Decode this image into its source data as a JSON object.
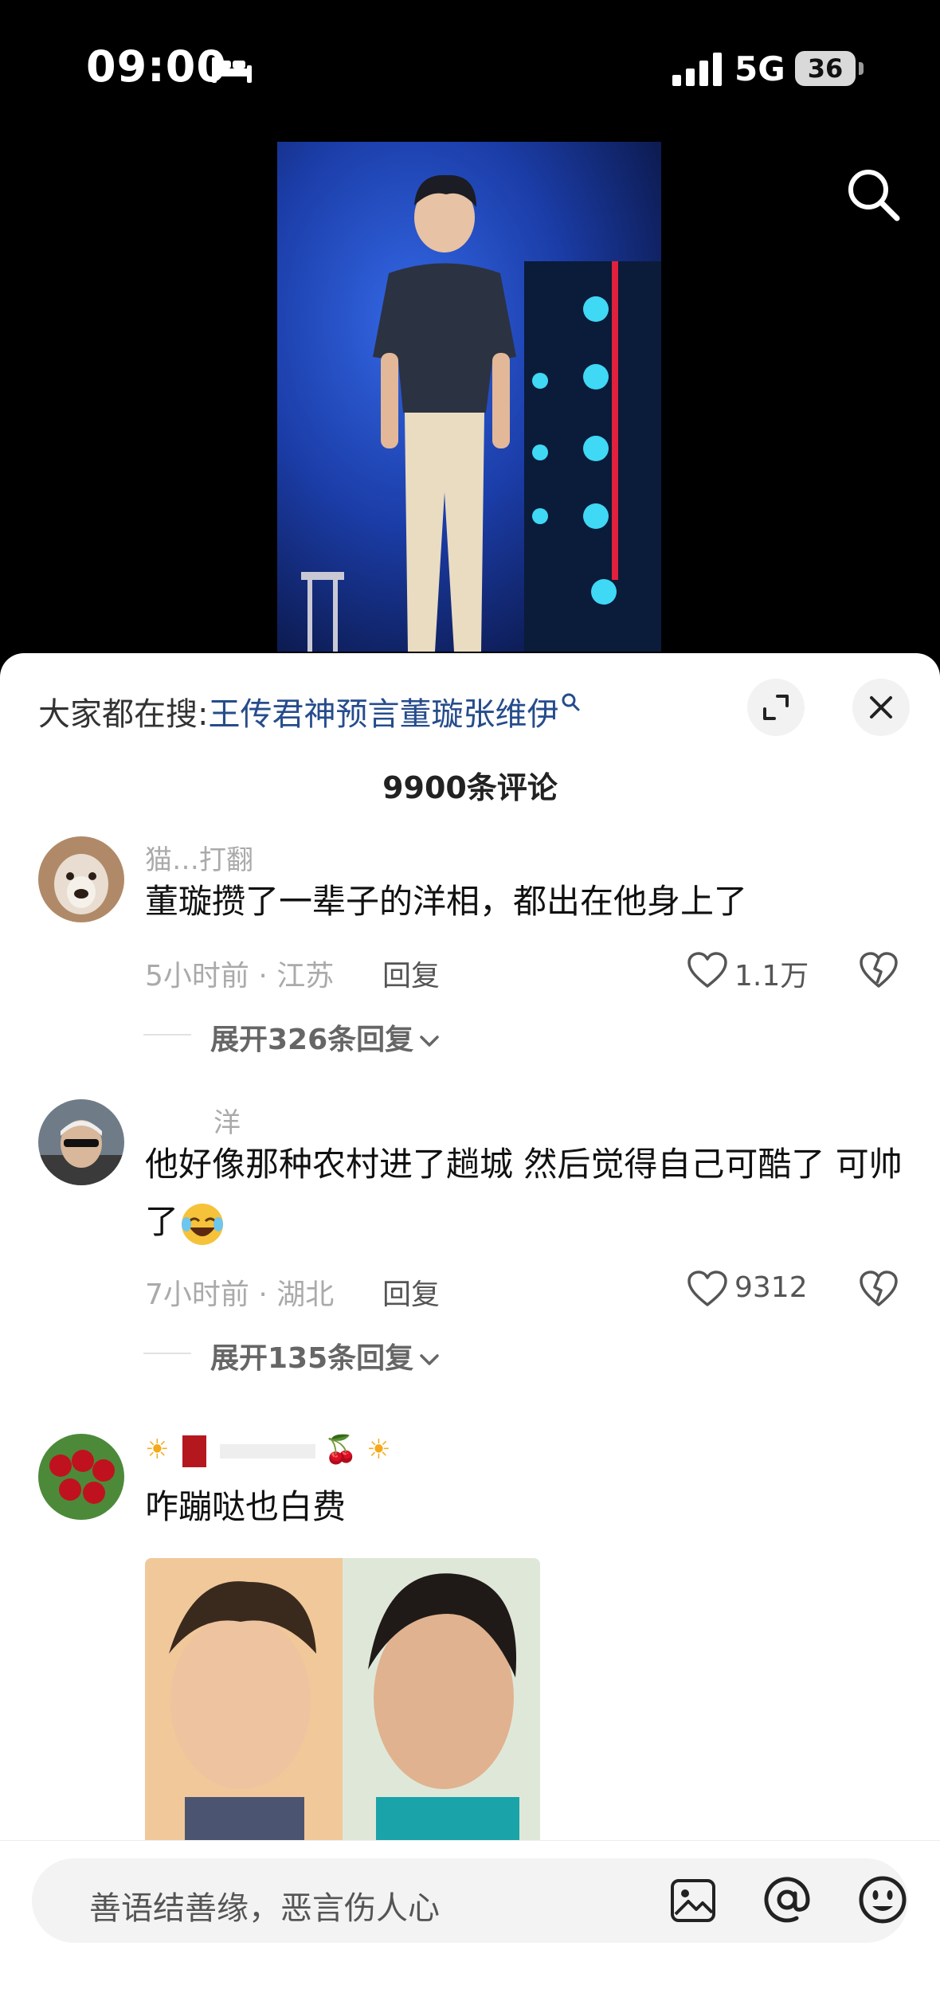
{
  "status_bar": {
    "time": "09:00",
    "network": "5G",
    "battery": "36"
  },
  "sheet": {
    "search_prefix": "大家都在搜:",
    "search_term": "王传君神预言董璇张维伊",
    "comment_count": "9900条评论"
  },
  "comments": [
    {
      "username": "猫…打翻",
      "text": "董璇攒了一辈子的洋相，都出在他身上了",
      "meta": "5小时前 · 江苏",
      "reply": "回复",
      "likes": "1.1万",
      "expand": "展开326条回复"
    },
    {
      "username": "洋",
      "text": "他好像那种农村进了趟城 然后觉得自己可酷了 可帅了",
      "meta": "7小时前 · 湖北",
      "reply": "回复",
      "likes": "9312",
      "expand": "展开135条回复"
    },
    {
      "username": "",
      "text": "咋蹦哒也白费"
    }
  ],
  "input_bar": {
    "placeholder": "善语结善缘，恶言伤人心"
  },
  "colors": {
    "accent_link": "#264c8c",
    "sheet_bg": "#ffffff",
    "video_bg": "#1d3fa8"
  },
  "icons": [
    "bed-icon",
    "signal-icon",
    "search-icon",
    "expand-icon",
    "close-icon",
    "like-icon",
    "dislike-icon",
    "chevron-down-icon",
    "image-icon",
    "at-icon",
    "emoji-icon"
  ]
}
